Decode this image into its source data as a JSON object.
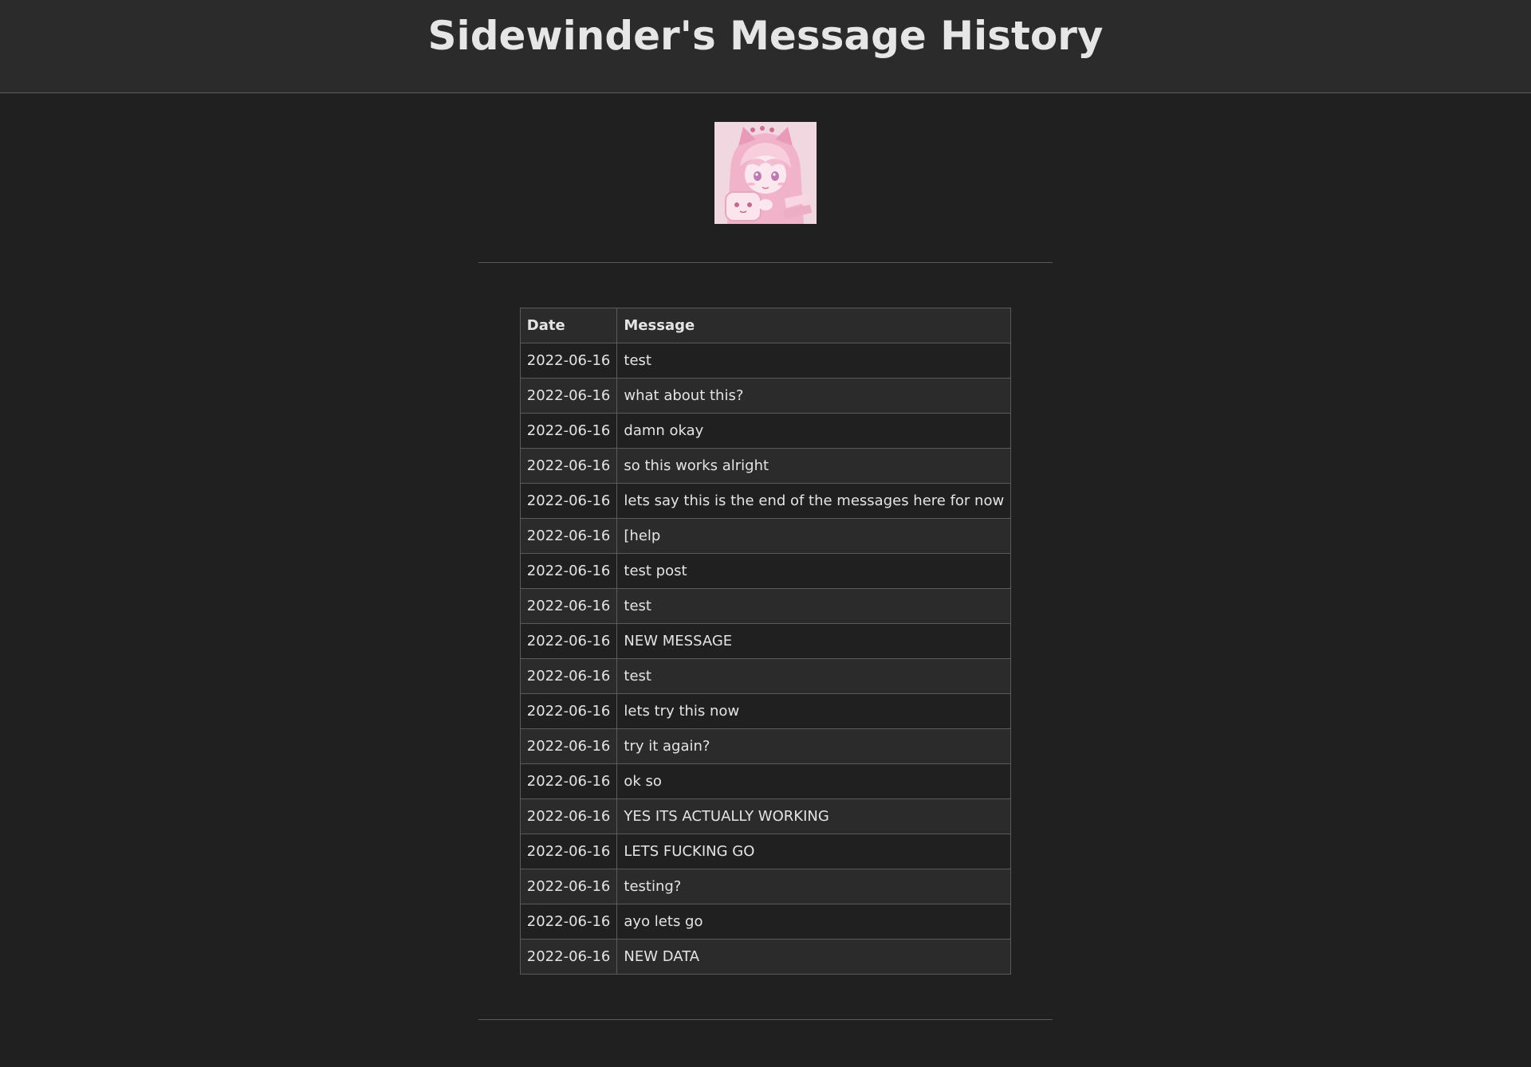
{
  "page": {
    "title": "Sidewinder's Message History"
  },
  "avatar": {
    "icon": "avatar-anime-girl-pink-hood",
    "tint": "#f2b8cf"
  },
  "table": {
    "headers": {
      "date": "Date",
      "message": "Message"
    },
    "rows": [
      {
        "date": "2022-06-16",
        "message": "test"
      },
      {
        "date": "2022-06-16",
        "message": "what about this?"
      },
      {
        "date": "2022-06-16",
        "message": "damn okay"
      },
      {
        "date": "2022-06-16",
        "message": "so this works alright"
      },
      {
        "date": "2022-06-16",
        "message": "lets say this is the end of the messages here for now"
      },
      {
        "date": "2022-06-16",
        "message": "[help"
      },
      {
        "date": "2022-06-16",
        "message": "test post"
      },
      {
        "date": "2022-06-16",
        "message": "test"
      },
      {
        "date": "2022-06-16",
        "message": "NEW MESSAGE"
      },
      {
        "date": "2022-06-16",
        "message": "test"
      },
      {
        "date": "2022-06-16",
        "message": "lets try this now"
      },
      {
        "date": "2022-06-16",
        "message": "try it again?"
      },
      {
        "date": "2022-06-16",
        "message": "ok so"
      },
      {
        "date": "2022-06-16",
        "message": "YES ITS ACTUALLY WORKING"
      },
      {
        "date": "2022-06-16",
        "message": "LETS FUCKING GO"
      },
      {
        "date": "2022-06-16",
        "message": "testing?"
      },
      {
        "date": "2022-06-16",
        "message": "ayo lets go"
      },
      {
        "date": "2022-06-16",
        "message": "NEW DATA"
      }
    ]
  }
}
